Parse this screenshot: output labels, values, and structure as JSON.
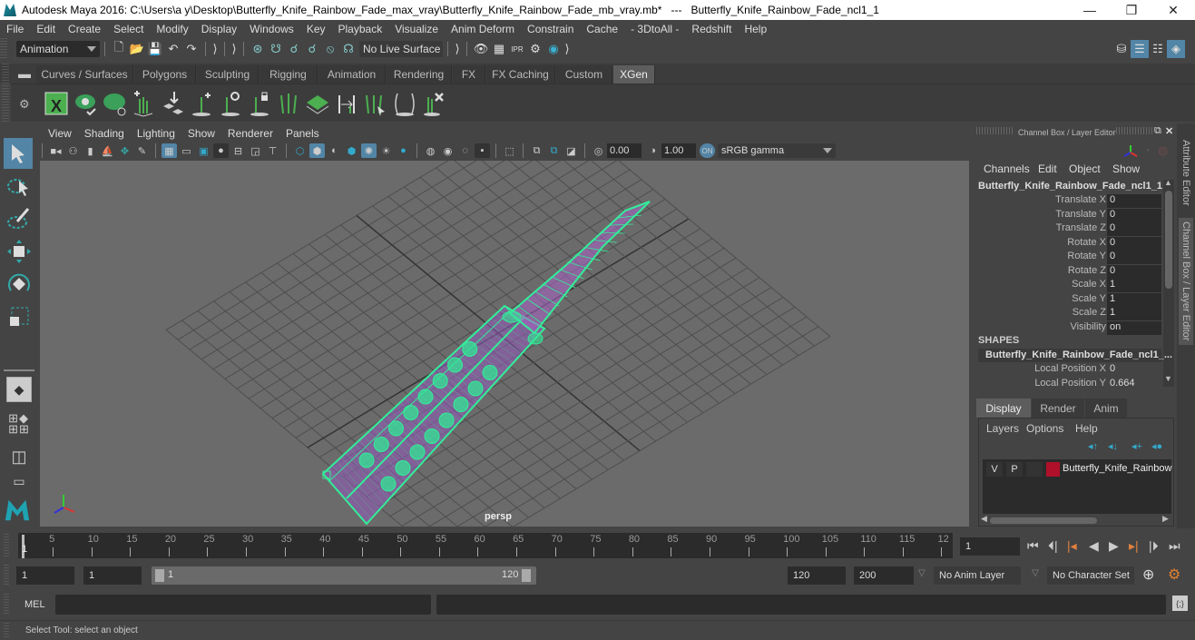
{
  "window": {
    "title": "Autodesk Maya 2016: C:\\Users\\a y\\Desktop\\Butterfly_Knife_Rainbow_Fade_max_vray\\Butterfly_Knife_Rainbow_Fade_mb_vray.mb*   ---   Butterfly_Knife_Rainbow_Fade_ncl1_1",
    "minimize": "—",
    "maximize": "❐",
    "close": "✕"
  },
  "menubar": [
    "File",
    "Edit",
    "Create",
    "Select",
    "Modify",
    "Display",
    "Windows",
    "Key",
    "Playback",
    "Visualize",
    "Anim Deform",
    "Constrain",
    "Cache",
    "- 3DtoAll -",
    "Redshift",
    "Help"
  ],
  "statusline": {
    "menuset": "Animation",
    "live_surface": "No Live Surface",
    "icons": [
      "new-scene-icon",
      "open-scene-icon",
      "save-scene-icon",
      "undo-icon",
      "redo-icon",
      "select-by-hierarchy-icon",
      "select-by-object-icon",
      "select-by-component-icon",
      "snap-grid-icon",
      "snap-curve-icon",
      "snap-point-icon",
      "render-view-icon",
      "render-icon",
      "ipr-render-icon",
      "render-settings-icon",
      "hypershade-icon"
    ]
  },
  "shelf": {
    "tabs": [
      "Curves / Surfaces",
      "Polygons",
      "Sculpting",
      "Rigging",
      "Animation",
      "Rendering",
      "FX",
      "FX Caching",
      "Custom",
      "XGen"
    ],
    "active_tab": "XGen",
    "icons": [
      "xgen-window-icon",
      "xgen-preview-icon",
      "xgen-clear-preview-icon",
      "xgen-add-guide-icon",
      "xgen-guide-move-icon",
      "xgen-add-guide-single-icon",
      "xgen-rotate-guide-icon",
      "xgen-lock-guide-icon",
      "xgen-flip-guide-icon",
      "xgen-scalp-icon",
      "xgen-guide-length-icon",
      "xgen-select-guide-icon",
      "xgen-guide-bend-icon",
      "xgen-delete-guide-icon"
    ]
  },
  "viewport": {
    "menu": [
      "View",
      "Shading",
      "Lighting",
      "Show",
      "Renderer",
      "Panels"
    ],
    "exposure": "0.00",
    "gamma": "1.00",
    "color_space": "sRGB gamma",
    "camera_label": "persp",
    "wire_color": "#33ee99"
  },
  "channelbox": {
    "title": "Channel Box / Layer Editor",
    "menu": [
      "Channels",
      "Edit",
      "Object",
      "Show"
    ],
    "object_name": "Butterfly_Knife_Rainbow_Fade_ncl1_1",
    "channels": [
      {
        "label": "Translate X",
        "value": "0"
      },
      {
        "label": "Translate Y",
        "value": "0"
      },
      {
        "label": "Translate Z",
        "value": "0"
      },
      {
        "label": "Rotate X",
        "value": "0"
      },
      {
        "label": "Rotate Y",
        "value": "0"
      },
      {
        "label": "Rotate Z",
        "value": "0"
      },
      {
        "label": "Scale X",
        "value": "1"
      },
      {
        "label": "Scale Y",
        "value": "1"
      },
      {
        "label": "Scale Z",
        "value": "1"
      },
      {
        "label": "Visibility",
        "value": "on"
      }
    ],
    "shapes_header": "SHAPES",
    "shape_name": "Butterfly_Knife_Rainbow_Fade_ncl1_...",
    "shape_channels": [
      {
        "label": "Local Position X",
        "value": "0"
      },
      {
        "label": "Local Position Y",
        "value": "0.664"
      }
    ]
  },
  "layereditor": {
    "tabs": [
      "Display",
      "Render",
      "Anim"
    ],
    "active_tab": "Display",
    "menu": [
      "Layers",
      "Options",
      "Help"
    ],
    "layer": {
      "v": "V",
      "p": "P",
      "name": "Butterfly_Knife_Rainbow",
      "color": "#b0102a"
    }
  },
  "sidetabs": [
    "Attribute Editor",
    "Channel Box / Layer Editor"
  ],
  "timeslider": {
    "ticks": [
      5,
      10,
      15,
      20,
      25,
      30,
      35,
      40,
      45,
      50,
      55,
      60,
      65,
      70,
      75,
      80,
      85,
      90,
      95,
      100,
      105,
      110,
      115,
      "12"
    ],
    "current_marker": "1",
    "current_frame": "1"
  },
  "range": {
    "start": "1",
    "playback_start": "1",
    "slider_min": "1",
    "slider_max": "120",
    "playback_end": "120",
    "end": "200",
    "anim_layer": "No Anim Layer",
    "character_set": "No Character Set"
  },
  "cmdline": {
    "label": "MEL",
    "value": ""
  },
  "helpline": "Select Tool: select an object"
}
